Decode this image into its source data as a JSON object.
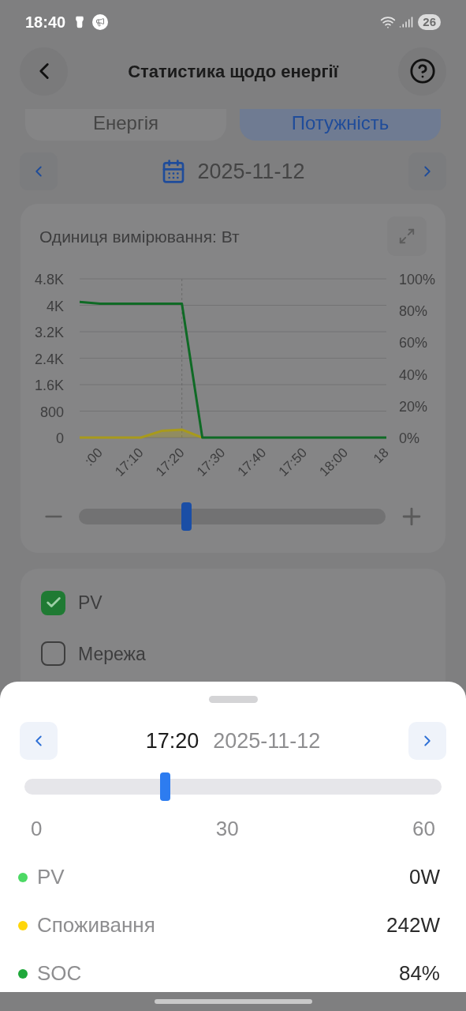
{
  "status_bar": {
    "time": "18:40",
    "battery": "26"
  },
  "header": {
    "title": "Статистика щодо енергії"
  },
  "tabs": [
    {
      "label": "Енергія",
      "selected": false
    },
    {
      "label": "Потужність",
      "selected": true
    }
  ],
  "date_nav": {
    "date": "2025-11-12"
  },
  "chart_card": {
    "unit_label": "Одиниця вимірювання: Вт",
    "right_axis_labels": [
      "100%",
      "80%",
      "60%",
      "40%",
      "20%",
      "0%"
    ],
    "zoom": {
      "level": 0.35
    },
    "chart_data": {
      "type": "line",
      "categories": [
        null,
        ":00",
        null,
        "17:10",
        null,
        "17:20",
        null,
        "17:30",
        null,
        "17:40",
        null,
        "17:50",
        null,
        "18:00",
        null,
        "18"
      ],
      "ylim": [
        0,
        4800
      ],
      "grid": true,
      "yticks": [
        {
          "value": 0,
          "label": "0"
        },
        {
          "value": 800,
          "label": "800"
        },
        {
          "value": 1600,
          "label": "1.6K"
        },
        {
          "value": 2400,
          "label": "2.4K"
        },
        {
          "value": 3200,
          "label": "3.2K"
        },
        {
          "value": 4000,
          "label": "4K"
        },
        {
          "value": 4800,
          "label": "4.8K"
        }
      ],
      "series": [
        {
          "color": "#a89a1c",
          "values": [
            0,
            0,
            0,
            0,
            200,
            240,
            0,
            null,
            null,
            null,
            null,
            null,
            null,
            null,
            null,
            null
          ]
        },
        {
          "color": "#0f6a25",
          "values": [
            4100,
            4050,
            4050,
            4050,
            4050,
            4050,
            0,
            0,
            0,
            0,
            0,
            0,
            0,
            0,
            0,
            0
          ]
        }
      ]
    }
  },
  "legend_toggles": [
    {
      "label": "PV",
      "checked": true
    },
    {
      "label": "Мережа",
      "checked": false
    }
  ],
  "sheet": {
    "time": "17:20",
    "date": "2025-11-12",
    "slider": {
      "level": 0.336
    },
    "scale_labels": [
      "0",
      "30",
      "60"
    ],
    "readings": [
      {
        "label": "PV",
        "value": "0W",
        "color": "#4cd964"
      },
      {
        "label": "Споживання",
        "value": "242W",
        "color": "#ffd60a"
      },
      {
        "label": "SOC",
        "value": "84%",
        "color": "#1fa83a"
      }
    ]
  }
}
